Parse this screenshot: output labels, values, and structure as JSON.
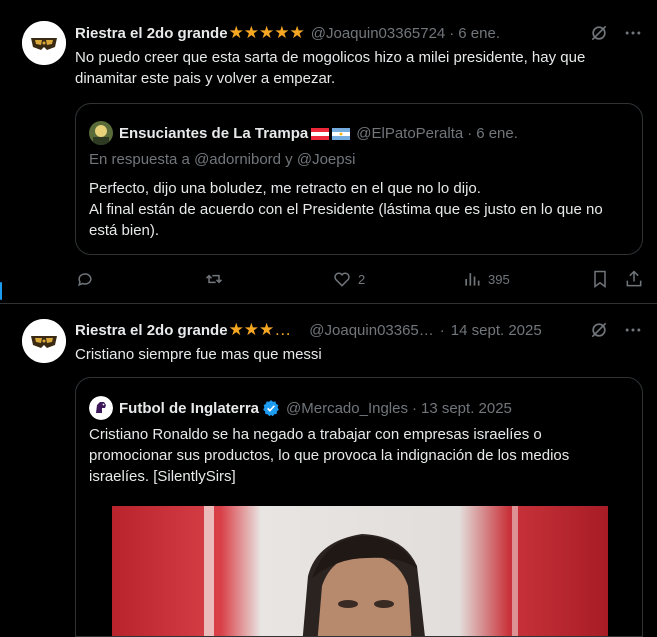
{
  "tweets": [
    {
      "author_name": "Riestra el 2do grande",
      "author_stars": "★★★★★",
      "handle": "@Joaquin03365724",
      "separator": "·",
      "date": "6 ene.",
      "text": "No puedo creer que esta sarta de mogolicos hizo a milei presidente, hay que dinamitar este pais y volver a empezar.",
      "quote": {
        "author_name": "Ensuciantes de La Trampa",
        "handle": "@ElPatoPeralta",
        "separator": "·",
        "date": "6 ene.",
        "reply_to": "En respuesta a @adornibord y @Joepsi",
        "text_line1": "Perfecto, dijo una boludez, me retracto en el que no lo dijo.",
        "text_line2": "Al final están de acuerdo con el Presidente (lástima que es justo en lo que no está bien)."
      },
      "actions": {
        "reply_count": "",
        "retweet_count": "",
        "like_count": "2",
        "views_count": "395"
      }
    },
    {
      "author_name": "Riestra el 2do grande",
      "author_stars": "★★★…",
      "handle": "@Joaquin03365…",
      "separator": "·",
      "date": "14 sept. 2025",
      "text": "Cristiano siempre fue mas que messi",
      "quote": {
        "author_name": "Futbol de Inglaterra",
        "handle": "@Mercado_Ingles",
        "separator": "·",
        "date": "13 sept. 2025",
        "text": "Cristiano Ronaldo se ha negado a trabajar con empresas israelíes o promocionar sus productos, lo que provoca la indignación de los medios israelíes.  [SilentlySirs]"
      }
    }
  ],
  "colors": {
    "background": "#000000",
    "text": "#e7e9ea",
    "muted": "#71767b",
    "border": "#2f3336",
    "accent": "#1d9bf0",
    "stars": "#f5a623"
  },
  "icons": [
    "grok-icon",
    "more-icon",
    "reply-icon",
    "retweet-icon",
    "like-icon",
    "views-icon",
    "bookmark-icon",
    "share-icon",
    "verified-badge-icon"
  ]
}
